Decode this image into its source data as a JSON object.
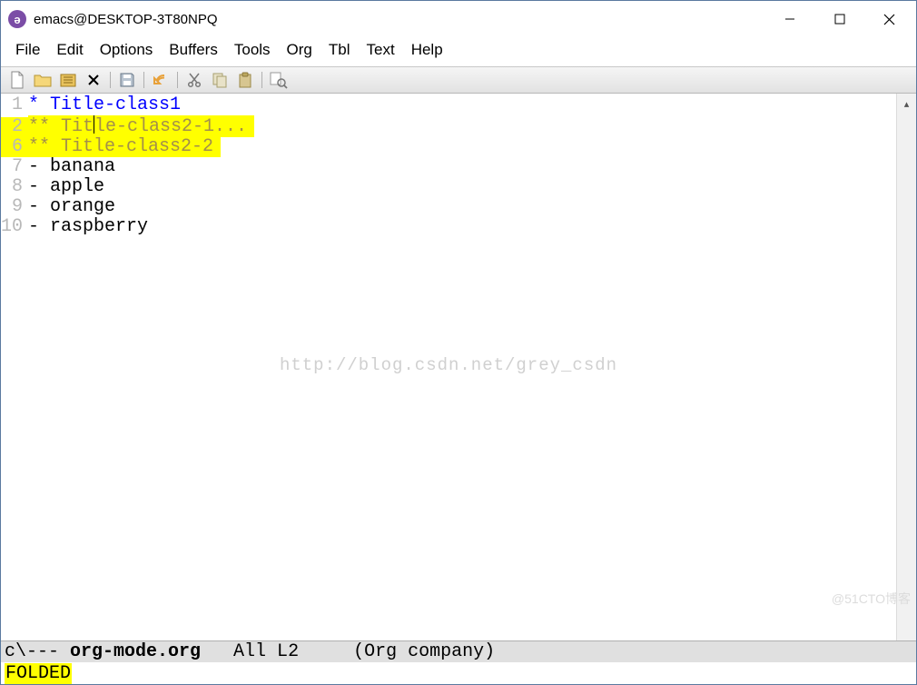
{
  "window": {
    "title": "emacs@DESKTOP-3T80NPQ"
  },
  "menubar": [
    "File",
    "Edit",
    "Options",
    "Buffers",
    "Tools",
    "Org",
    "Tbl",
    "Text",
    "Help"
  ],
  "toolbar": {
    "items": [
      "new-file",
      "open-folder",
      "directory",
      "close",
      "save",
      "undo",
      "cut",
      "copy",
      "paste",
      "search"
    ]
  },
  "editor": {
    "lines": [
      {
        "num": "1",
        "text": "* Title-class1",
        "cls": "level1",
        "hl": false
      },
      {
        "num": "2",
        "text": "** Title-class2-1...",
        "cls": "level2",
        "hl": true,
        "cursor_at": 6
      },
      {
        "num": "6",
        "text": "** Title-class2-2",
        "cls": "level2",
        "hl": true
      },
      {
        "num": "7",
        "text": "- banana",
        "cls": "body-text",
        "hl": false
      },
      {
        "num": "8",
        "text": "- apple",
        "cls": "body-text",
        "hl": false
      },
      {
        "num": "9",
        "text": "- orange",
        "cls": "body-text",
        "hl": false
      },
      {
        "num": "10",
        "text": "- raspberry",
        "cls": "body-text",
        "hl": false
      }
    ],
    "watermark": "http://blog.csdn.net/grey_csdn",
    "corner_mark": "@51CTO博客"
  },
  "modeline": {
    "left": "c\\--- ",
    "buffer": "org-mode.org",
    "middle": "   All L2     (Org company)"
  },
  "minibuffer": {
    "message": "FOLDED"
  }
}
